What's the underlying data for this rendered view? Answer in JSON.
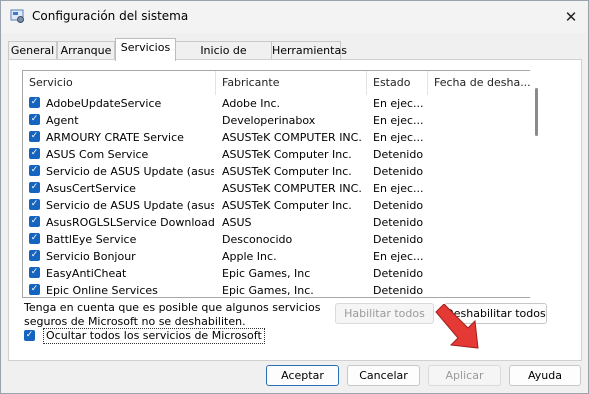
{
  "window": {
    "title": "Configuración del sistema",
    "close_glyph": "✕"
  },
  "tabs": [
    {
      "label": "General"
    },
    {
      "label": "Arranque"
    },
    {
      "label": "Servicios"
    },
    {
      "label": "Inicio de Windows"
    },
    {
      "label": "Herramientas"
    }
  ],
  "columns": [
    "Servicio",
    "Fabricante",
    "Estado",
    "Fecha de desha..."
  ],
  "rows": [
    {
      "service": "AdobeUpdateService",
      "manufacturer": "Adobe Inc.",
      "status": "En ejec..."
    },
    {
      "service": "Agent",
      "manufacturer": "Developerinabox",
      "status": "En ejec..."
    },
    {
      "service": "ARMOURY CRATE Service",
      "manufacturer": "ASUSTeK COMPUTER INC.",
      "status": "En ejec..."
    },
    {
      "service": "ASUS Com Service",
      "manufacturer": "ASUSTeK Computer Inc.",
      "status": "Detenido"
    },
    {
      "service": "Servicio de ASUS Update (asus)",
      "manufacturer": "ASUSTeK Computer Inc.",
      "status": "Detenido"
    },
    {
      "service": "AsusCertService",
      "manufacturer": "ASUSTeK COMPUTER INC.",
      "status": "En ejec..."
    },
    {
      "service": "Servicio de ASUS Update (asusm)",
      "manufacturer": "ASUSTeK Computer Inc.",
      "status": "Detenido"
    },
    {
      "service": "AsusROGLSLService Download R...",
      "manufacturer": "ASUS",
      "status": "Detenido"
    },
    {
      "service": "BattlEye Service",
      "manufacturer": "Desconocido",
      "status": "Detenido"
    },
    {
      "service": "Servicio Bonjour",
      "manufacturer": "Apple Inc.",
      "status": "En ejec..."
    },
    {
      "service": "EasyAntiCheat",
      "manufacturer": "Epic Games, Inc",
      "status": "Detenido"
    },
    {
      "service": "Epic Online Services",
      "manufacturer": "Epic Games, Inc.",
      "status": "Detenido"
    }
  ],
  "note": "Tenga en cuenta que es posible que algunos servicios seguros de Microsoft no se deshabiliten.",
  "buttons": {
    "enable_all": "Habilitar todos",
    "disable_all": "Deshabilitar todos",
    "ok": "Aceptar",
    "cancel": "Cancelar",
    "apply": "Aplicar",
    "help": "Ayuda"
  },
  "hide_ms_label": "Ocultar todos los servicios de Microsoft",
  "check_glyph": "✓",
  "colors": {
    "checkbox": "#1565c0",
    "arrow": "#e53935",
    "primary_border": "#2a6fb8"
  }
}
